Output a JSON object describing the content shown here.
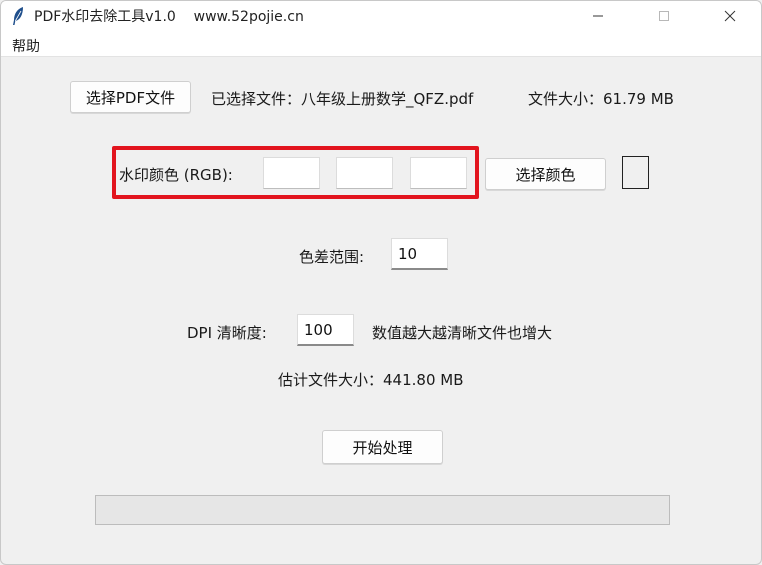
{
  "window": {
    "title": "PDF水印去除工具v1.0    www.52pojie.cn",
    "icon": "feather-icon"
  },
  "menu": {
    "items": [
      "帮助"
    ]
  },
  "file_section": {
    "select_button": "选择PDF文件",
    "selected_file_text": "已选择文件：八年级上册数学_QFZ.pdf",
    "file_size_text": "文件大小：61.79 MB"
  },
  "color_section": {
    "label": "水印颜色 (RGB):",
    "r_value": "",
    "g_value": "",
    "b_value": "",
    "choose_color_button": "选择颜色",
    "swatch_color": "#f0f0f0",
    "highlight_color": "#e2141e"
  },
  "tolerance": {
    "label": "色差范围:",
    "value": "10"
  },
  "dpi": {
    "label": "DPI 清晰度:",
    "value": "100",
    "hint": "数值越大越清晰文件也增大"
  },
  "estimate": {
    "text": "估计文件大小：441.80 MB"
  },
  "actions": {
    "start_button": "开始处理"
  },
  "progress": {
    "value": 0
  }
}
